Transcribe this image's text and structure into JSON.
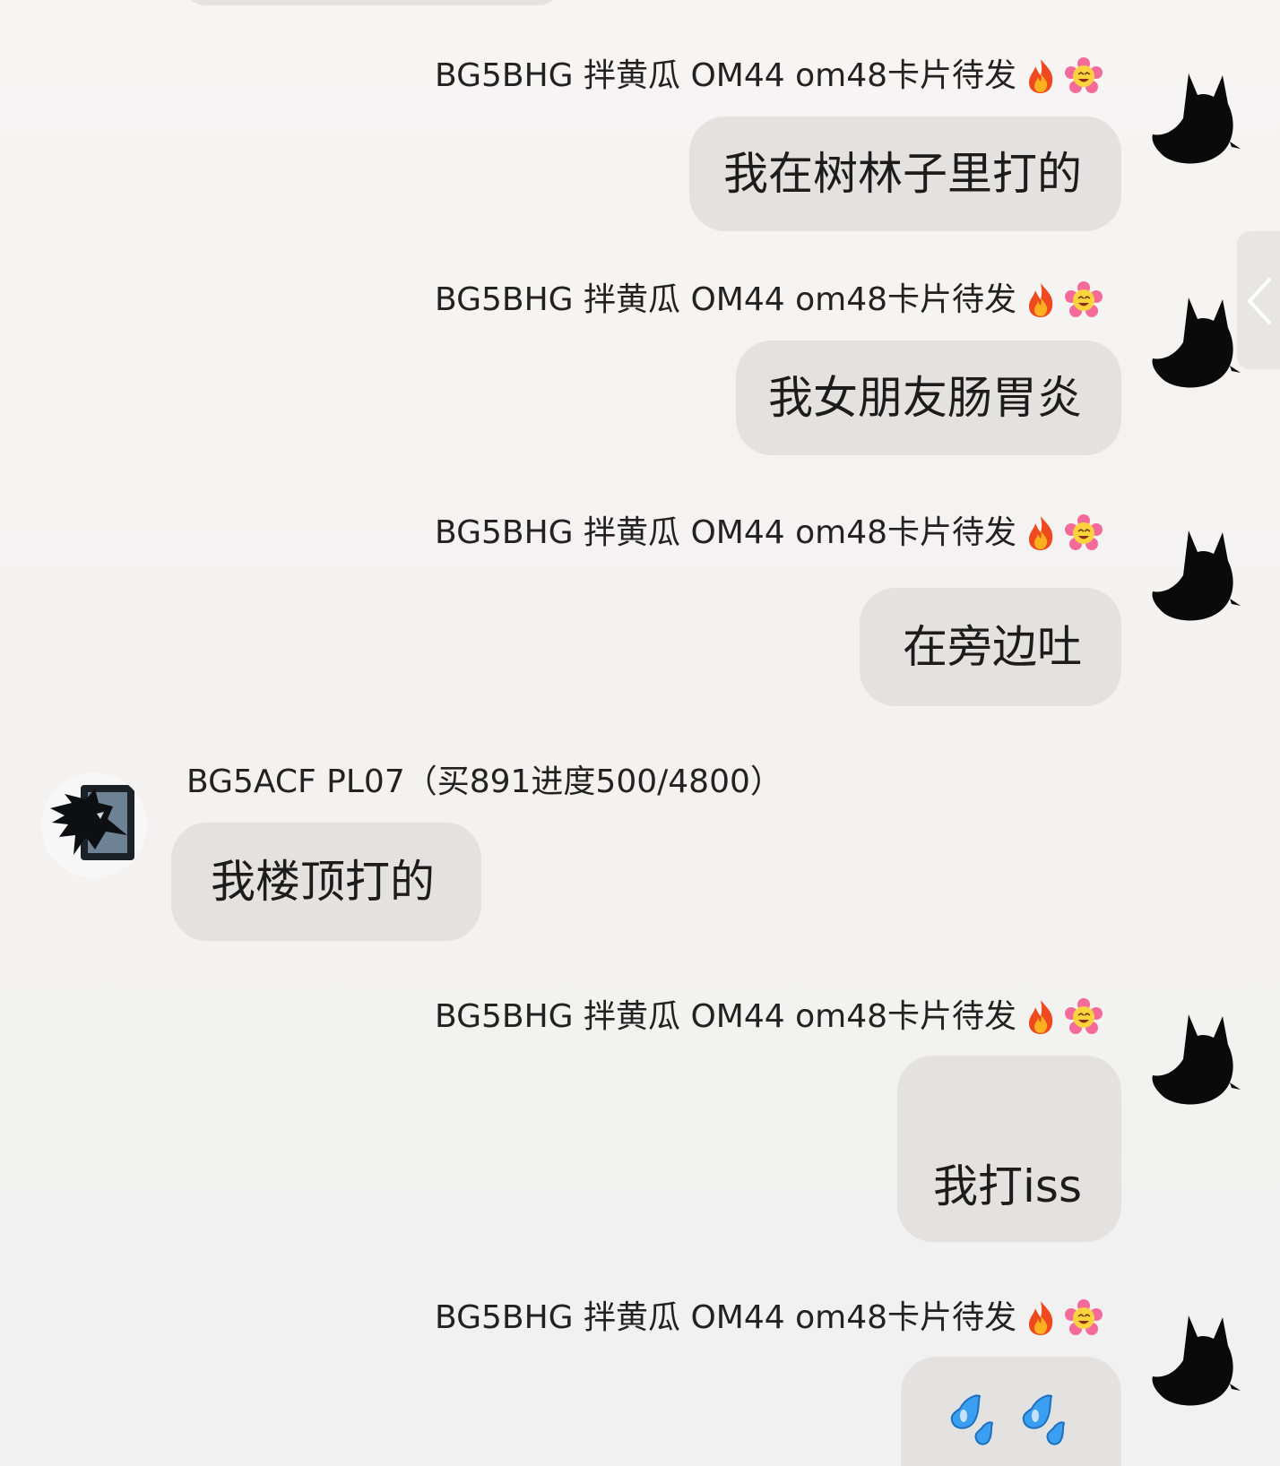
{
  "chat": {
    "messages": [
      {
        "side": "right",
        "sender": "BG5BHG 拌黄瓜 OM44 om48卡片待发",
        "sender_emojis": [
          "fire-emoji",
          "flower-smile-emoji"
        ],
        "text": "我在树林子里打的"
      },
      {
        "side": "right",
        "sender": "BG5BHG 拌黄瓜 OM44 om48卡片待发",
        "sender_emojis": [
          "fire-emoji",
          "flower-smile-emoji"
        ],
        "text": "我女朋友肠胃炎"
      },
      {
        "side": "right",
        "sender": "BG5BHG 拌黄瓜 OM44 om48卡片待发",
        "sender_emojis": [
          "fire-emoji",
          "flower-smile-emoji"
        ],
        "text": "在旁边吐"
      },
      {
        "side": "left",
        "sender": "BG5ACF PL07（买891进度500/4800）",
        "text": "我楼顶打的"
      },
      {
        "side": "right",
        "sender": "BG5BHG 拌黄瓜 OM44 om48卡片待发",
        "sender_emojis": [
          "fire-emoji",
          "flower-smile-emoji"
        ],
        "text": "我打iss"
      },
      {
        "side": "right",
        "sender": "BG5BHG 拌黄瓜 OM44 om48卡片待发",
        "sender_emojis": [
          "fire-emoji",
          "flower-smile-emoji"
        ],
        "text": "💦💦"
      }
    ]
  },
  "icons": {
    "right_avatar": "black-cat-silhouette-avatar",
    "left_avatar": "dark-wolf-logo-avatar",
    "side_handle": "chevron-left-icon"
  },
  "colors": {
    "bubble": "#e3e2e1",
    "background": "#f3f2f1"
  }
}
